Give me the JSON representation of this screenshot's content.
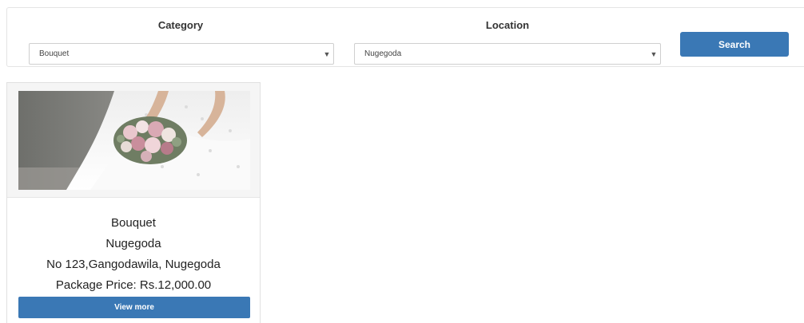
{
  "search": {
    "category_label": "Category",
    "category_value": "Bouquet",
    "location_label": "Location",
    "location_value": "Nugegoda",
    "button_label": "Search",
    "dropdown_icon": "▼"
  },
  "results": [
    {
      "image_icon": "bride-bouquet-photo",
      "category": "Bouquet",
      "location": "Nugegoda",
      "address": "No 123,Gangodawila, Nugegoda",
      "price": "Package Price: Rs.12,000.00",
      "button_label": "View more"
    }
  ],
  "colors": {
    "primary": "#3a78b5",
    "panel_border": "#e4e4e4"
  }
}
